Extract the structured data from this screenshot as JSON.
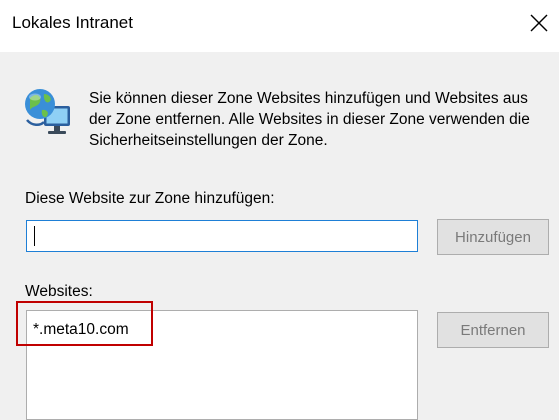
{
  "window": {
    "title": "Lokales Intranet",
    "close_icon": "close-icon"
  },
  "info": {
    "icon": "globe-monitor-icon",
    "text": "Sie können dieser Zone Websites hinzufügen und Websites aus der Zone entfernen. Alle Websites in dieser Zone verwenden die Sicherheitseinstellungen der Zone."
  },
  "add_site": {
    "label": "Diese Website zur Zone hinzufügen:",
    "value": "",
    "button_label": "Hinzufügen"
  },
  "websites": {
    "label": "Websites:",
    "items": [
      "*.meta10.com"
    ],
    "remove_button_label": "Entfernen"
  },
  "colors": {
    "input_border_focus": "#1e7fd6",
    "highlight_box": "#c00000",
    "button_disabled_text": "#7a7a7a"
  }
}
